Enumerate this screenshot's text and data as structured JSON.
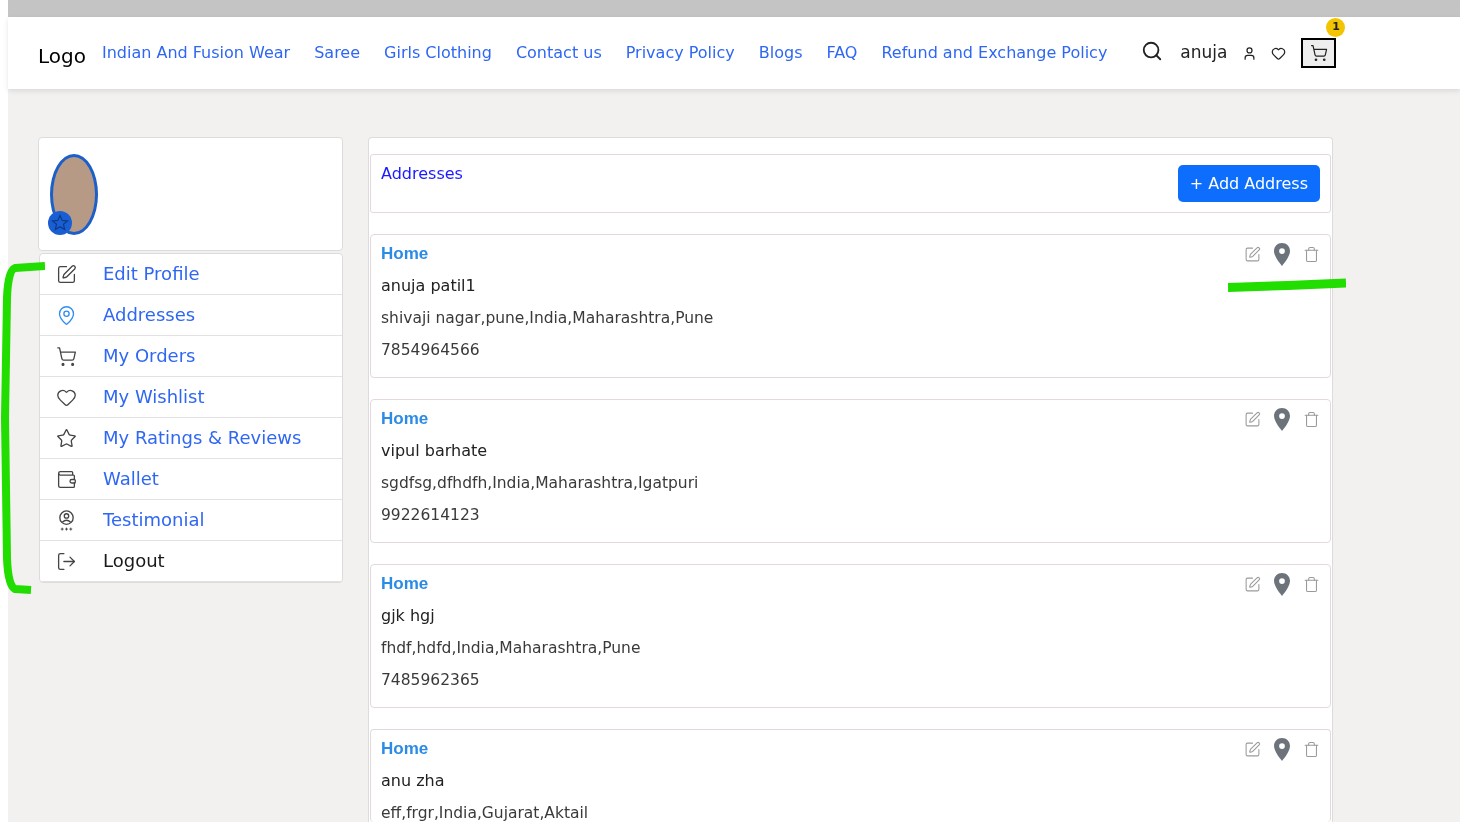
{
  "header": {
    "logo": "Logo",
    "nav": [
      "Indian And Fusion Wear",
      "Saree",
      "Girls Clothing",
      "Contact us",
      "Privacy Policy",
      "Blogs",
      "FAQ",
      "Refund and Exchange Policy"
    ],
    "user_name": "anuja",
    "cart_count": "1"
  },
  "sidebar": {
    "marked": true,
    "items": [
      {
        "label": "Edit Profile",
        "kind": "link",
        "selected": false
      },
      {
        "label": "Addresses",
        "kind": "link",
        "selected": true
      },
      {
        "label": "My Orders",
        "kind": "link",
        "selected": false
      },
      {
        "label": "My Wishlist",
        "kind": "link",
        "selected": false
      },
      {
        "label": "My Ratings & Reviews",
        "kind": "link",
        "selected": false
      },
      {
        "label": "Wallet",
        "kind": "link",
        "selected": false
      },
      {
        "label": "Testimonial",
        "kind": "link",
        "selected": false
      },
      {
        "label": "Logout",
        "kind": "action",
        "selected": false
      }
    ]
  },
  "addresses": {
    "title": "Addresses",
    "add_button": "+ Add Address",
    "items": [
      {
        "label": "Home",
        "name": "anuja patil1",
        "address": "shivaji nagar,pune,India,Maharashtra,Pune",
        "phone": "7854964566",
        "marked": true
      },
      {
        "label": "Home",
        "name": "vipul barhate",
        "address": "sgdfsg,dfhdfh,India,Maharashtra,Igatpuri",
        "phone": "9922614123",
        "marked": false
      },
      {
        "label": "Home",
        "name": "gjk hgj",
        "address": "fhdf,hdfd,India,Maharashtra,Pune",
        "phone": "7485962365",
        "marked": false
      },
      {
        "label": "Home",
        "name": "anu zha",
        "address": "eff,frgr,India,Gujarat,Aktail",
        "marked": false
      }
    ]
  }
}
